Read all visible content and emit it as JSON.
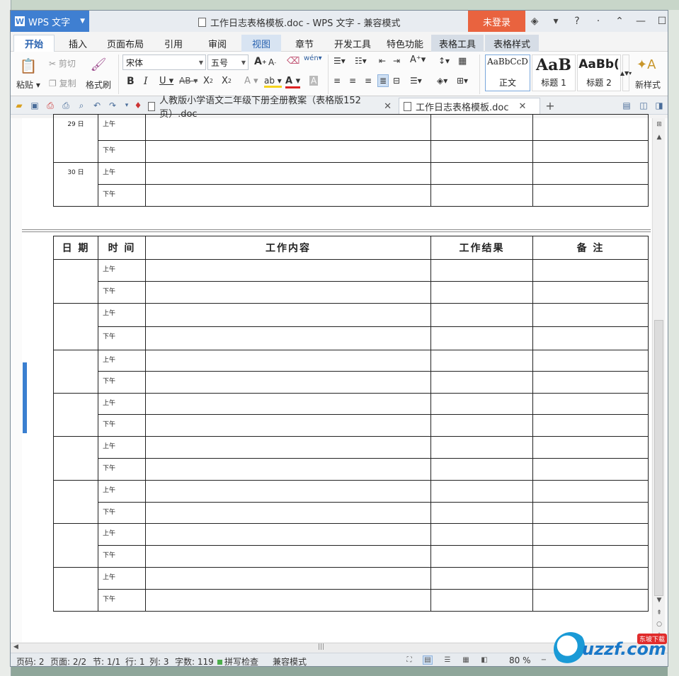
{
  "app": {
    "menu_label": "WPS 文字"
  },
  "window": {
    "title": "工作日志表格模板.doc - WPS 文字 - 兼容模式",
    "login_label": "未登录"
  },
  "tabs": [
    "开始",
    "插入",
    "页面布局",
    "引用",
    "审阅",
    "视图",
    "章节",
    "开发工具",
    "特色功能",
    "表格工具",
    "表格样式"
  ],
  "ribbon": {
    "paste": "粘贴",
    "cut": "剪切",
    "copy": "复制",
    "format_painter": "格式刷",
    "font_name": "宋体",
    "font_size": "五号",
    "styles": [
      {
        "preview": "AaBbCcD",
        "name": "正文"
      },
      {
        "preview": "AaB",
        "name": "标题 1"
      },
      {
        "preview": "AaBb(",
        "name": "标题 2"
      }
    ],
    "new_style": "新样式"
  },
  "doc_tabs": [
    {
      "label": "人教版小学语文二年级下册全册教案（表格版152页）.doc"
    },
    {
      "label": "工作日志表格模板.doc"
    }
  ],
  "table": {
    "headers": [
      "日 期",
      "时 间",
      "工作内容",
      "工作结果",
      "备 注"
    ],
    "am": "上午",
    "pm": "下午",
    "prev_days": [
      "29 日",
      "30 日"
    ]
  },
  "status": {
    "page_code": "页码: 2",
    "pages": "页面: 2/2",
    "section": "节: 1/1",
    "row": "行: 1",
    "col": "列: 3",
    "words": "字数: 119",
    "spell_check": "拼写检查",
    "compat_mode": "兼容模式",
    "zoom": "80 %"
  },
  "watermark": {
    "text": "uzzf.com",
    "tag": "东坡下载"
  },
  "colors": {
    "accent": "#3f7fd1",
    "login": "#e9633f",
    "tab_active_text": "#2a63b0"
  }
}
